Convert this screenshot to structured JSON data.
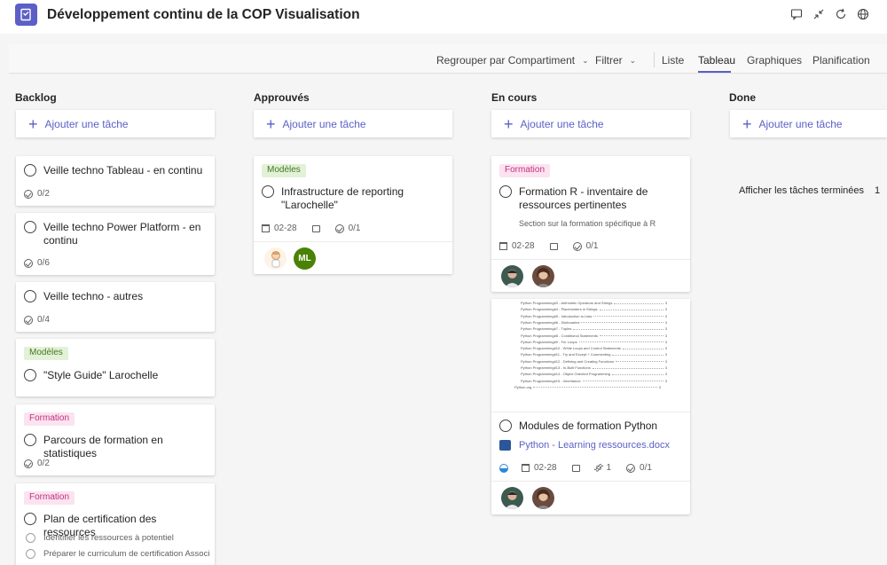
{
  "app": {
    "title": "Développement continu de la COP Visualisation"
  },
  "icons": [
    "chat-icon",
    "collapse-icon",
    "refresh-icon",
    "globe-icon"
  ],
  "toolbar": {
    "group_by": "Regrouper par Compartiment",
    "filter": "Filtrer",
    "views": [
      "Liste",
      "Tableau",
      "Graphiques",
      "Planification"
    ],
    "active_view": "Tableau"
  },
  "colors": {
    "accent": "#5b5fc7",
    "tag_green_bg": "#e3f1d8",
    "tag_pink_bg": "#fbe3f0"
  },
  "add_task_label": "Ajouter une tâche",
  "columns": {
    "backlog": {
      "title": "Backlog",
      "cards": [
        {
          "title": "Veille techno Tableau - en continu",
          "checklist": "0/2"
        },
        {
          "title": "Veille techno Power Platform - en continu",
          "checklist": "0/6"
        },
        {
          "title": "Veille techno - autres",
          "checklist": "0/4"
        },
        {
          "tag": "Modèles",
          "title": "\"Style Guide\" Larochelle"
        },
        {
          "tag": "Formation",
          "title": "Parcours de formation en statistiques",
          "checklist": "0/2"
        },
        {
          "tag": "Formation",
          "title": "Plan de certification des ressources",
          "subtasks": [
            "Identifier les ressources à potentiel",
            "Préparer le curriculum de certification Associ"
          ]
        }
      ]
    },
    "approuves": {
      "title": "Approuvés",
      "cards": [
        {
          "tag": "Modèles",
          "title": "Infrastructure de reporting \"Larochelle\"",
          "date": "02-28",
          "checklist": "0/1",
          "assignee_initials": "ML"
        }
      ]
    },
    "en_cours": {
      "title": "En cours",
      "cards": [
        {
          "tag": "Formation",
          "title": "Formation R - inventaire de ressources pertinentes",
          "description": "Section sur la formation spécifique à R",
          "date": "02-28",
          "checklist": "0/1"
        },
        {
          "title": "Modules de formation Python",
          "attachment": "Python - Learning ressources.docx",
          "date": "02-28",
          "attachments_count": "1",
          "checklist": "0/1",
          "preview_lines": [
            {
              "text": "Python Programming#3 - Arithmetic Operators and Strings",
              "page": "3"
            },
            {
              "text": "Python Programming#4 - Placeholders in Strings",
              "page": "3"
            },
            {
              "text": "Python Programming#5 - Introduction to Lists",
              "page": "3"
            },
            {
              "text": "Python Programming#6 - Dictionaries",
              "page": "3"
            },
            {
              "text": "Python Programming#7 - Tuples",
              "page": "3"
            },
            {
              "text": "Python Programming#8 - Conditional Statements",
              "page": "3"
            },
            {
              "text": "Python Programming#9 - For Loops",
              "page": "3"
            },
            {
              "text": "Python Programming#10 - While Loops and Control Statements",
              "page": "3"
            },
            {
              "text": "Python Programming#11 - Try and Except + Commenting",
              "page": "3"
            },
            {
              "text": "Python Programming#12 - Defining and Creating Functions",
              "page": "3"
            },
            {
              "text": "Python Programming#13 - In-Built Functions",
              "page": "3"
            },
            {
              "text": "Python Programming#14 - Object Oriented Programming",
              "page": "3"
            },
            {
              "text": "Python Programming#15 - Inheritance",
              "page": "3"
            },
            {
              "text": "Python.org",
              "page": "3"
            }
          ]
        }
      ]
    },
    "done": {
      "title": "Done",
      "show_completed": "Afficher les tâches terminées",
      "completed_count": "1"
    }
  }
}
